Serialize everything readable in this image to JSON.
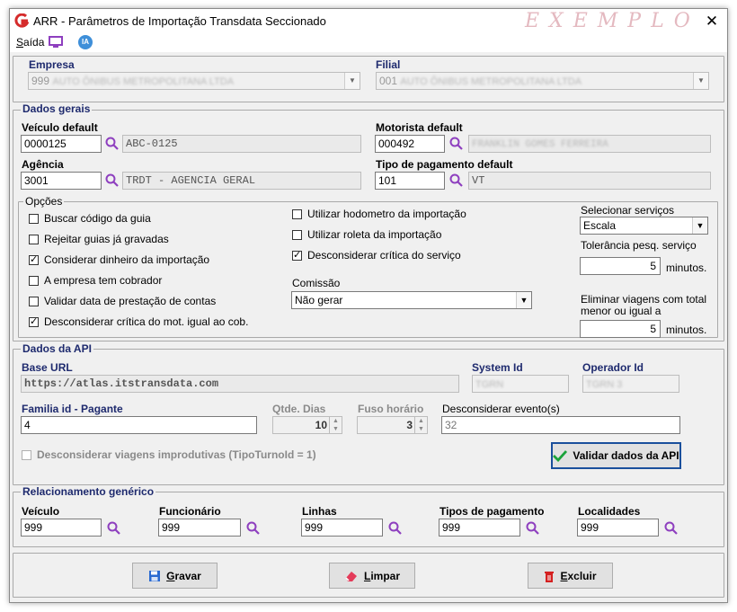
{
  "window": {
    "title": "ARR - Parâmetros de Importação Transdata Seccionado",
    "watermark": "EXEMPLO",
    "close_glyph": "✕"
  },
  "menu": {
    "sair_label": "Saída",
    "ia_label": "IA"
  },
  "empresa": {
    "label": "Empresa",
    "value_code": "999",
    "value_name": "AUTO ÔNIBUS METROPOLITANA LTDA"
  },
  "filial": {
    "label": "Filial",
    "value_code": "001",
    "value_name": "AUTO ÔNIBUS METROPOLITANA LTDA"
  },
  "dados_gerais": {
    "title": "Dados gerais",
    "veiculo_label": "Veículo default",
    "veiculo_code": "0000125",
    "veiculo_desc": "ABC-0125",
    "motorista_label": "Motorista default",
    "motorista_code": "000492",
    "motorista_desc": "FRANKLIN GOMES FERREIRA",
    "agencia_label": "Agência",
    "agencia_code": "3001",
    "agencia_desc": "TRDT - AGENCIA GERAL",
    "tipo_pag_label": "Tipo de pagamento default",
    "tipo_pag_code": "101",
    "tipo_pag_desc": "VT"
  },
  "opcoes": {
    "title": "Opções",
    "left_checks": [
      {
        "label": "Buscar código da guia",
        "checked": false
      },
      {
        "label": "Rejeitar guias já gravadas",
        "checked": false
      },
      {
        "label": "Considerar dinheiro da importação",
        "checked": true
      },
      {
        "label": "A empresa tem cobrador",
        "checked": false
      },
      {
        "label": "Validar data de prestação de contas",
        "checked": false
      },
      {
        "label": "Desconsiderar crítica do mot. igual ao cob.",
        "checked": true
      }
    ],
    "mid_checks": [
      {
        "label": "Utilizar hodometro da importação",
        "checked": false
      },
      {
        "label": "Utilizar roleta da importação",
        "checked": false
      },
      {
        "label": "Desconsiderar crítica do serviço",
        "checked": true
      }
    ],
    "comissao_label": "Comissão",
    "comissao_value": "Não gerar",
    "selecionar_servicos_label": "Selecionar serviços",
    "selecionar_servicos_value": "Escala",
    "tolerancia_label": "Tolerância pesq. serviço",
    "tolerancia_value": "5",
    "minutos_label": "minutos.",
    "eliminar_label_1": "Eliminar viagens com total",
    "eliminar_label_2": "menor ou igual a",
    "eliminar_value": "5"
  },
  "api": {
    "title": "Dados da API",
    "base_url_label": "Base URL",
    "base_url_value": "https://atlas.itstransdata.com",
    "system_id_label": "System Id",
    "system_id_value": "TGRN",
    "operador_id_label": "Operador Id",
    "operador_id_value": "TGRN 3",
    "familia_label": "Familia id - Pagante",
    "familia_value": "4",
    "qtde_dias_label": "Qtde. Dias",
    "qtde_dias_value": "10",
    "fuso_label": "Fuso horário",
    "fuso_value": "3",
    "desconsiderar_evento_label": "Desconsiderar evento(s)",
    "desconsiderar_evento_value": "32",
    "improdutivas_label": "Desconsiderar viagens improdutivas (TipoTurnoId = 1)",
    "validar_label": "Validar dados da API"
  },
  "relacionamento": {
    "title": "Relacionamento genérico",
    "items": [
      {
        "label": "Veículo",
        "value": "999"
      },
      {
        "label": "Funcionário",
        "value": "999"
      },
      {
        "label": "Linhas",
        "value": "999"
      },
      {
        "label": "Tipos de pagamento",
        "value": "999"
      },
      {
        "label": "Localidades",
        "value": "999"
      }
    ]
  },
  "buttons": {
    "gravar": "Gravar",
    "limpar": "Limpar",
    "excluir": "Excluir"
  },
  "colors": {
    "accent": "#1e2a6e",
    "watermark": "#e4b9c0",
    "search_icon": "#8e3fbf",
    "check_green": "#1aa23a",
    "excluir_red": "#d42020"
  }
}
